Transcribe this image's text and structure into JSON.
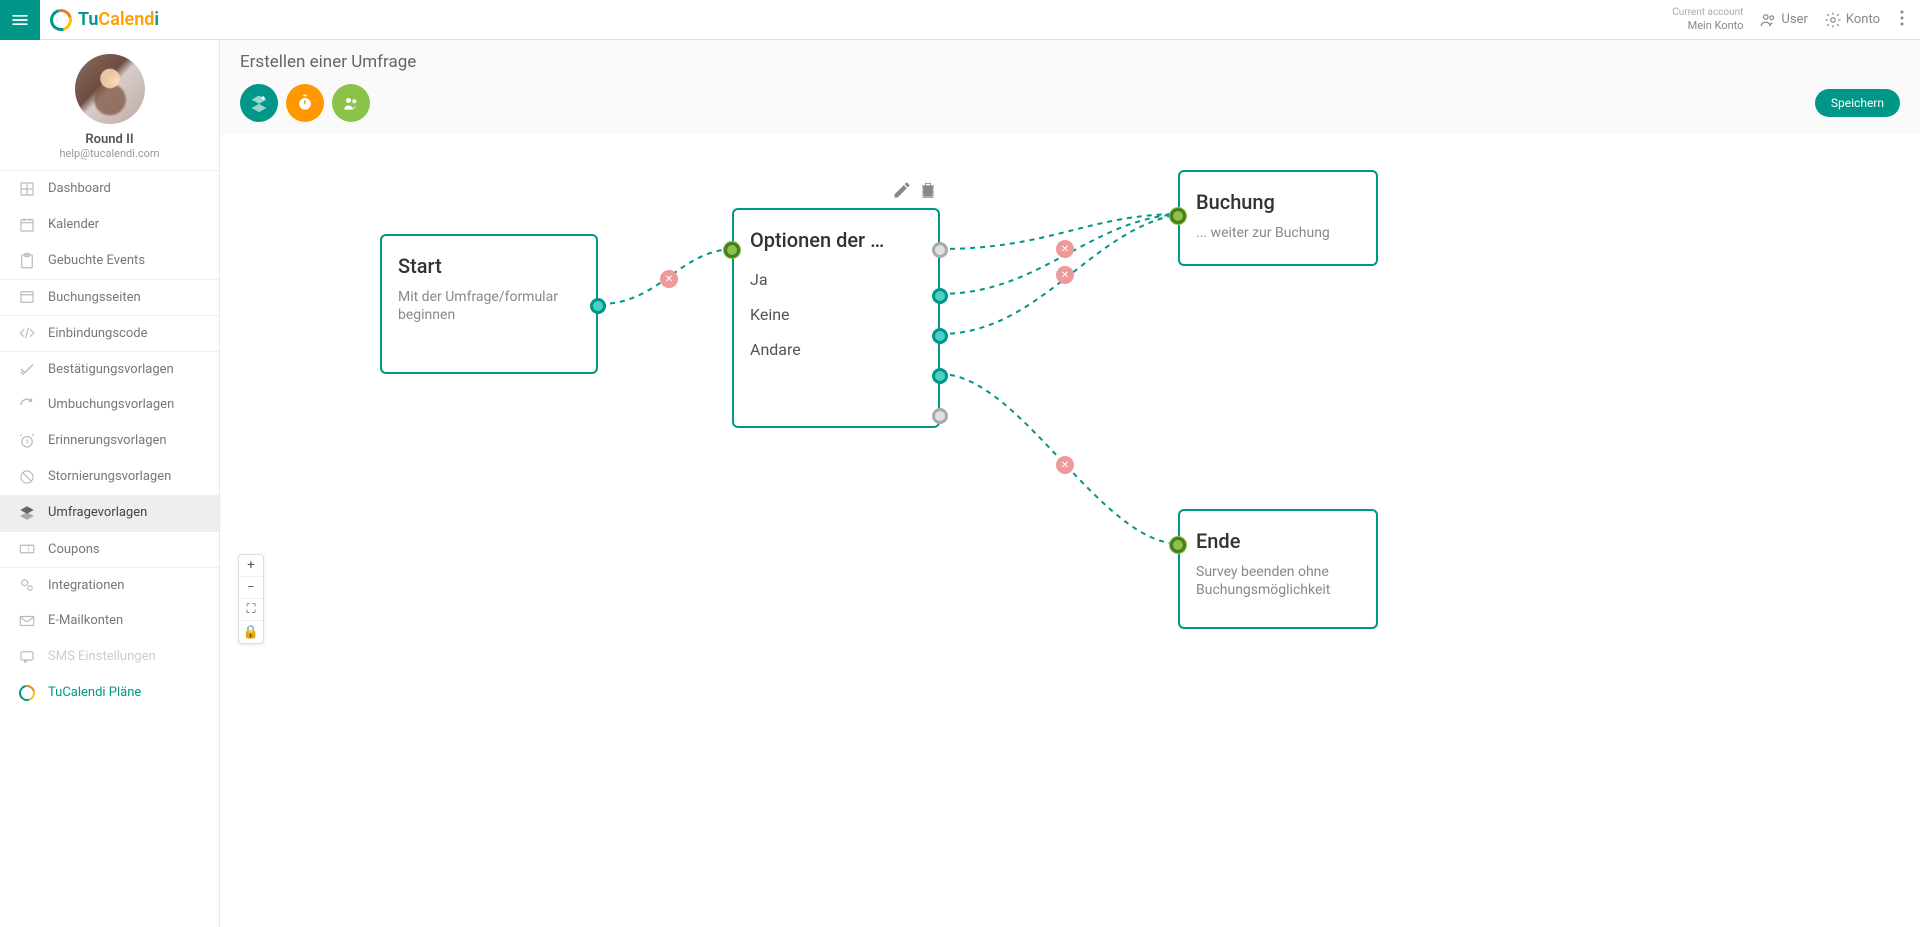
{
  "brand": {
    "tu": "Tu",
    "calend": "Calend",
    "i": "i"
  },
  "topbar": {
    "account_label": "Current account",
    "account_name": "Mein Konto",
    "user_label": "User",
    "konto_label": "Konto"
  },
  "profile": {
    "name": "Round II",
    "email": "help@tucalendi.com"
  },
  "nav": {
    "dashboard": "Dashboard",
    "kalender": "Kalender",
    "events": "Gebuchte Events",
    "booking_pages": "Buchungsseiten",
    "embed": "Einbindungscode",
    "confirm_tpl": "Bestätigungsvorlagen",
    "rebook_tpl": "Umbuchungsvorlagen",
    "reminder_tpl": "Erinnerungsvorlagen",
    "cancel_tpl": "Stornierungsvorlagen",
    "survey_tpl": "Umfragevorlagen",
    "coupons": "Coupons",
    "integrations": "Integrationen",
    "email_accounts": "E-Mailkonten",
    "sms": "SMS Einstellungen",
    "plans": "TuCalendi Pläne"
  },
  "page": {
    "title": "Erstellen einer Umfrage",
    "save": "Speichern"
  },
  "nodes": {
    "start": {
      "title": "Start",
      "desc": "Mit der Umfrage/formular beginnen"
    },
    "options": {
      "title": "Optionen der …",
      "opts": [
        "Ja",
        "Keine",
        "Andare"
      ]
    },
    "booking": {
      "title": "Buchung",
      "desc": "... weiter zur Buchung"
    },
    "end": {
      "title": "Ende",
      "desc": "Survey beenden ohne Buchungsmöglichkeit"
    }
  }
}
